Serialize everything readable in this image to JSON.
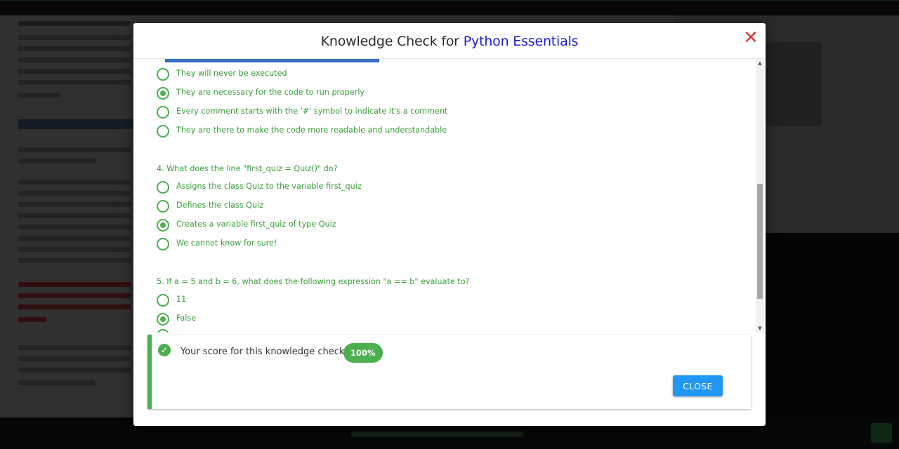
{
  "modal": {
    "title_prefix": "Knowledge Check for",
    "course_name": "Python Essentials",
    "close_icon": "✕"
  },
  "questions": [
    {
      "number": "",
      "text": "",
      "options": [
        {
          "label": "They will never be executed",
          "selected": false
        },
        {
          "label": "They are necessary for the code to run properly",
          "selected": true
        },
        {
          "label": "Every comment starts with the '#' symbol to indicate it's a comment",
          "selected": false
        },
        {
          "label": "They are there to make the code more readable and understandable",
          "selected": false
        }
      ]
    },
    {
      "number": "4.",
      "text": "What does the line \"first_quiz = Quiz()\" do?",
      "options": [
        {
          "label": "Assigns the class Quiz to the variable first_quiz",
          "selected": false
        },
        {
          "label": "Defines the class Quiz",
          "selected": false
        },
        {
          "label": "Creates a variable first_quiz of type Quiz",
          "selected": true
        },
        {
          "label": "We cannot know for sure!",
          "selected": false
        }
      ]
    },
    {
      "number": "5.",
      "text": "If a = 5 and b = 6, what does the following expression \"a == b\" evaluate to?",
      "options": [
        {
          "label": "11",
          "selected": false
        },
        {
          "label": "False",
          "selected": true
        }
      ]
    }
  ],
  "score": {
    "label": "Your score for this knowledge check:",
    "value": "100%",
    "close_label": "CLOSE"
  },
  "icons": {
    "check": "✓",
    "scroll_up": "▲",
    "scroll_down": "▼"
  },
  "colors": {
    "accent_green": "#4caf50",
    "text_green": "#3a9d3a",
    "title_blue": "#1a1acd",
    "close_red": "#e53935",
    "button_blue": "#2196f3"
  }
}
